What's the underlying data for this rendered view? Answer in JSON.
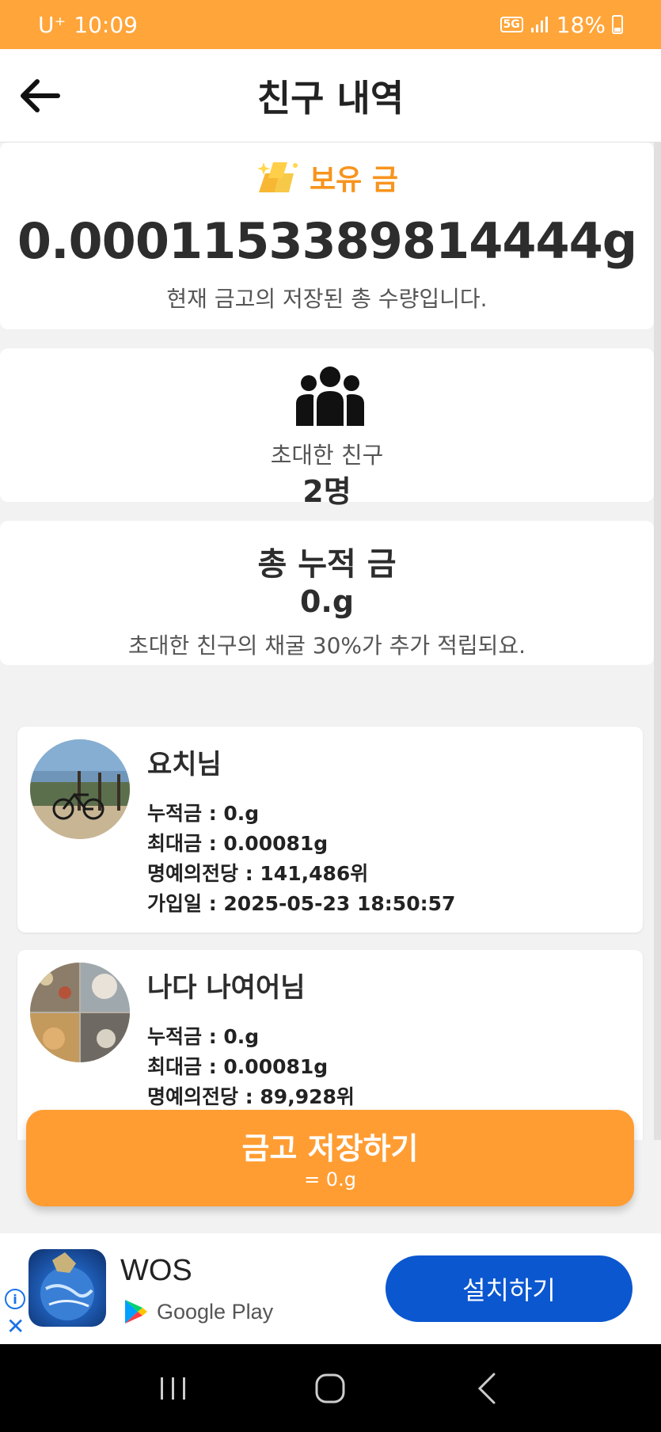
{
  "status_bar": {
    "carrier": "U⁺",
    "time": "10:09",
    "network": "5G",
    "battery": "18%"
  },
  "header": {
    "title": "친구 내역"
  },
  "gold_card": {
    "label": "보유 금",
    "amount": "0.0001153389814444g",
    "description": "현재 금고의 저장된 총 수량입니다."
  },
  "friends_card": {
    "label": "초대한 친구",
    "count": "2명"
  },
  "total_card": {
    "title": "총 누적 금",
    "amount": "0.g",
    "description": "초대한 친구의 채굴 30%가 추가 적립되요."
  },
  "friends": [
    {
      "name": "요치님",
      "accumulated": "누적금 : 0.g",
      "max": "최대금 : 0.00081g",
      "hall_of_fame": "명예의전당 : 141,486위",
      "joined": "가입일 : 2025-05-23 18:50:57"
    },
    {
      "name": "나다 나여어님",
      "accumulated": "누적금 : 0.g",
      "max": "최대금 : 0.00081g",
      "hall_of_fame": "명예의전당 : 89,928위"
    }
  ],
  "save_button": {
    "title": "금고 저장하기",
    "subtitle": "= 0.g"
  },
  "ad": {
    "app_name": "WOS",
    "store": "Google Play",
    "install_label": "설치하기"
  },
  "colors": {
    "accent": "#ffa53a",
    "install": "#0b57d0"
  }
}
